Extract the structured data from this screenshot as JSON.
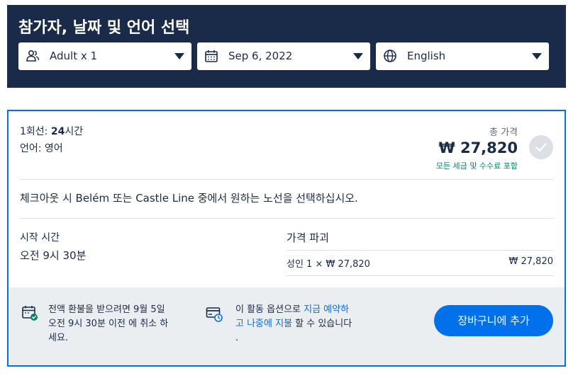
{
  "header": {
    "title": "참가자, 날짜 및 언어 선택",
    "participants": {
      "label": "Adult x 1",
      "icon": "people-icon"
    },
    "date": {
      "label": "Sep 6, 2022",
      "icon": "calendar-icon"
    },
    "language": {
      "label": "English",
      "icon": "globe-icon"
    }
  },
  "option": {
    "duration_prefix": "1회선: ",
    "duration_value": "24",
    "duration_suffix": "시간",
    "language_line": "언어: 영어",
    "price_label": "총 가격",
    "price_value": "₩ 27,820",
    "price_note": "모든 세금 및 수수료 포함",
    "select_note": "체크아웃 시 Belém 또는 Castle Line 중에서 원하는 노선을 선택하십시오.",
    "start_time_label": "시작 시간",
    "start_time_value": "오전 9시 30분",
    "price_breakdown_title": "가격 파괴",
    "breakdown_row_label": "성인 1 × ₩ 27,820",
    "breakdown_row_value": "₩ 27,820"
  },
  "footer": {
    "refund_line1": "전액 환불을 받으려면 9월 5일",
    "refund_line2": "오전 9시 30분 이전 에 취소 하",
    "refund_line3": "세요.",
    "reserve_prefix": "이 활동 옵션으로 ",
    "reserve_link1": "지금 예약하",
    "reserve_link2": "고 나중에 지불",
    "reserve_suffix": " 할 수 있습니다",
    "reserve_line3": ".",
    "add_to_cart": "장바구니에 추가"
  },
  "colors": {
    "navy": "#1a2b49",
    "accent": "#0071eb",
    "green": "#008768",
    "footer_bg": "#ebeef1"
  }
}
